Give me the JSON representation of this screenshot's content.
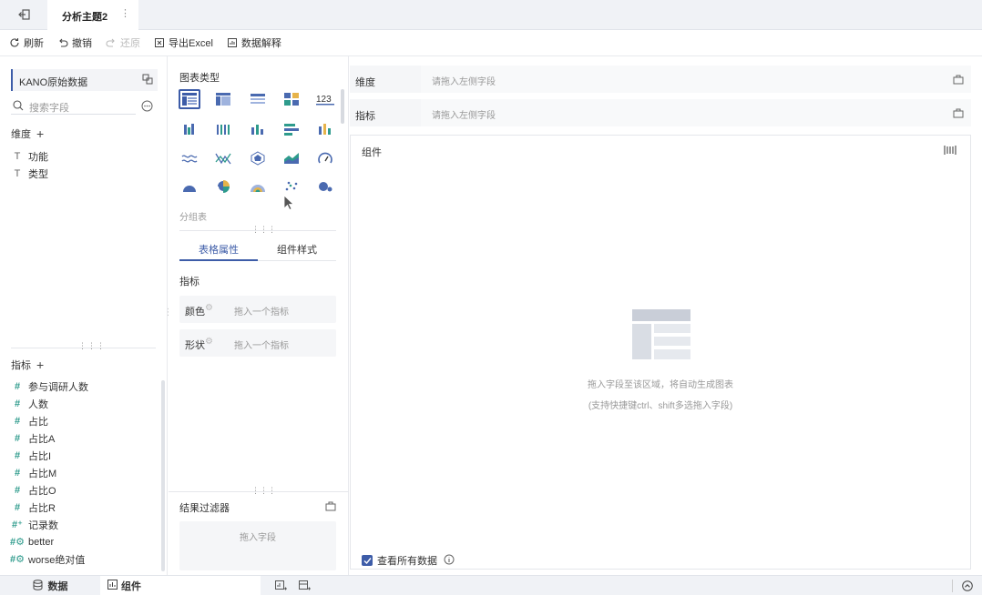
{
  "topbar": {
    "tab_title": "分析主题2"
  },
  "toolbar": {
    "refresh": "刷新",
    "undo": "撤销",
    "redo": "还原",
    "export": "导出Excel",
    "explain": "数据解释"
  },
  "left": {
    "dataset": "KANO原始数据",
    "search_placeholder": "搜索字段",
    "dimension_title": "维度",
    "dimensions": [
      "功能",
      "类型"
    ],
    "measure_title": "指标",
    "measures": [
      "参与调研人数",
      "人数",
      "占比",
      "占比A",
      "占比I",
      "占比M",
      "占比O",
      "占比R",
      "记录数",
      "better",
      "worse绝对值"
    ]
  },
  "mid": {
    "chart_type_title": "图表类型",
    "chart_hint": "分组表",
    "tab_props": "表格属性",
    "tab_style": "组件样式",
    "measure_title": "指标",
    "color_label": "颜色",
    "color_placeholder": "拖入一个指标",
    "shape_label": "形状",
    "shape_placeholder": "拖入一个指标",
    "filter_title": "结果过滤器",
    "filter_placeholder": "拖入字段"
  },
  "right": {
    "dim_label": "维度",
    "dim_placeholder": "请拖入左侧字段",
    "measure_label": "指标",
    "measure_placeholder": "请拖入左侧字段",
    "component_title": "组件",
    "empty_hint": "拖入字段至该区域，将自动生成图表",
    "empty_sub": "(支持快捷键ctrl、shift多选拖入字段)",
    "show_all_label": "查看所有数据",
    "show_all_checked": true
  },
  "bottom": {
    "tab_data": "数据",
    "tab_component": "组件"
  },
  "colors": {
    "accent": "#3d5ca8",
    "teal": "#2e9b8c",
    "bg": "#f0f2f6"
  }
}
